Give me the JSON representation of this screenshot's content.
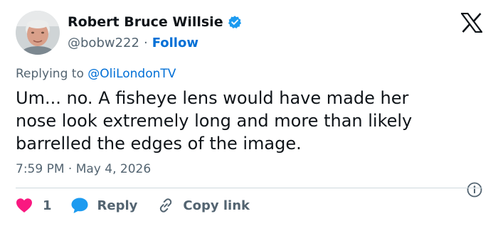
{
  "author": {
    "display_name": "Robert Bruce Willsie",
    "handle": "@bobw222",
    "separator": "·",
    "follow_label": "Follow",
    "avatar_icon": "person-photo-avatar",
    "verified_icon": "verified-badge-icon"
  },
  "header": {
    "logo_icon": "x-logo-icon"
  },
  "reply_context": {
    "prefix": "Replying to",
    "mention": "@OliLondonTV"
  },
  "tweet": {
    "lines": [
      "Um... no.  A fisheye lens would have made her",
      "nose look extremely long and more than likely",
      "barrelled the edges of the image."
    ],
    "time": "7:59 PM",
    "separator": "·",
    "date": "May 4, 2026"
  },
  "actions": {
    "like_count": "1",
    "reply_label": "Reply",
    "copy_link_label": "Copy link"
  },
  "colors": {
    "link": "#006fd6",
    "verified": "#1d9bf0",
    "like": "#f91880",
    "reply_bubble": "#1d9bf0",
    "secondary_text": "#536471",
    "divider": "#cfd9de"
  }
}
